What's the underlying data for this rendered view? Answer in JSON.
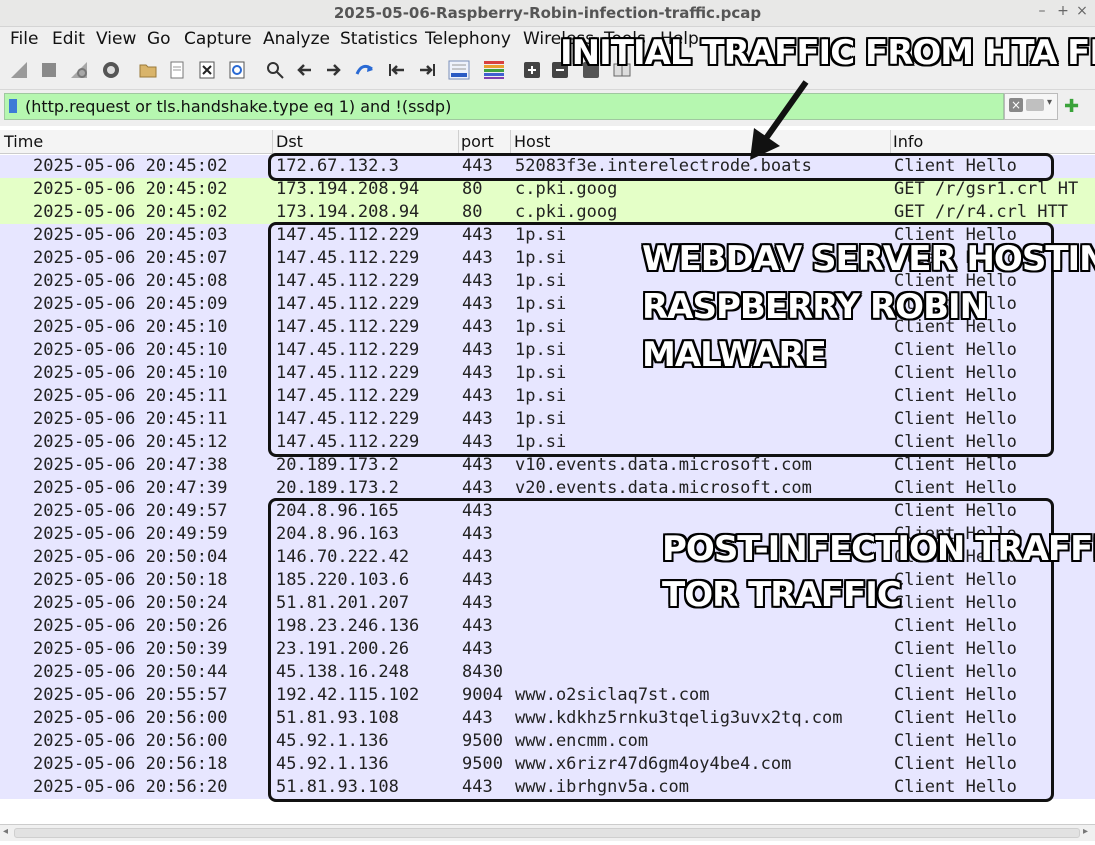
{
  "window": {
    "title": "2025-05-06-Raspberry-Robin-infection-traffic.pcap",
    "minimize": "–",
    "maximize": "+",
    "close": "×"
  },
  "menu": [
    "File",
    "Edit",
    "View",
    "Go",
    "Capture",
    "Analyze",
    "Statistics",
    "Telephony",
    "Wireless",
    "Tools",
    "Help"
  ],
  "filter": {
    "value": "(http.request or tls.handshake.type eq 1) and !(ssdp)"
  },
  "columns": {
    "time": "Time",
    "dst": "Dst",
    "port": "port",
    "host": "Host",
    "info": "Info"
  },
  "colors": {
    "row_tls": "#e7e6ff",
    "row_http": "#e4ffc7",
    "filter_bg": "#b6f7b0"
  },
  "packets": [
    {
      "time": "2025-05-06 20:45:02",
      "dst": "172.67.132.3",
      "port": "443",
      "host": "52083f3e.interelectrode.boats",
      "info": "Client Hello",
      "kind": "tls"
    },
    {
      "time": "2025-05-06 20:45:02",
      "dst": "173.194.208.94",
      "port": "80",
      "host": "c.pki.goog",
      "info": "GET /r/gsr1.crl HT",
      "kind": "http"
    },
    {
      "time": "2025-05-06 20:45:02",
      "dst": "173.194.208.94",
      "port": "80",
      "host": "c.pki.goog",
      "info": "GET /r/r4.crl HTT",
      "kind": "http"
    },
    {
      "time": "2025-05-06 20:45:03",
      "dst": "147.45.112.229",
      "port": "443",
      "host": "1p.si",
      "info": "Client Hello",
      "kind": "tls"
    },
    {
      "time": "2025-05-06 20:45:07",
      "dst": "147.45.112.229",
      "port": "443",
      "host": "1p.si",
      "info": "Client Hello",
      "kind": "tls"
    },
    {
      "time": "2025-05-06 20:45:08",
      "dst": "147.45.112.229",
      "port": "443",
      "host": "1p.si",
      "info": "Client Hello",
      "kind": "tls"
    },
    {
      "time": "2025-05-06 20:45:09",
      "dst": "147.45.112.229",
      "port": "443",
      "host": "1p.si",
      "info": "Client Hello",
      "kind": "tls"
    },
    {
      "time": "2025-05-06 20:45:10",
      "dst": "147.45.112.229",
      "port": "443",
      "host": "1p.si",
      "info": "Client Hello",
      "kind": "tls"
    },
    {
      "time": "2025-05-06 20:45:10",
      "dst": "147.45.112.229",
      "port": "443",
      "host": "1p.si",
      "info": "Client Hello",
      "kind": "tls"
    },
    {
      "time": "2025-05-06 20:45:10",
      "dst": "147.45.112.229",
      "port": "443",
      "host": "1p.si",
      "info": "Client Hello",
      "kind": "tls"
    },
    {
      "time": "2025-05-06 20:45:11",
      "dst": "147.45.112.229",
      "port": "443",
      "host": "1p.si",
      "info": "Client Hello",
      "kind": "tls"
    },
    {
      "time": "2025-05-06 20:45:11",
      "dst": "147.45.112.229",
      "port": "443",
      "host": "1p.si",
      "info": "Client Hello",
      "kind": "tls"
    },
    {
      "time": "2025-05-06 20:45:12",
      "dst": "147.45.112.229",
      "port": "443",
      "host": "1p.si",
      "info": "Client Hello",
      "kind": "tls"
    },
    {
      "time": "2025-05-06 20:47:38",
      "dst": "20.189.173.2",
      "port": "443",
      "host": "v10.events.data.microsoft.com",
      "info": "Client Hello",
      "kind": "tls"
    },
    {
      "time": "2025-05-06 20:47:39",
      "dst": "20.189.173.2",
      "port": "443",
      "host": "v20.events.data.microsoft.com",
      "info": "Client Hello",
      "kind": "tls"
    },
    {
      "time": "2025-05-06 20:49:57",
      "dst": "204.8.96.165",
      "port": "443",
      "host": "",
      "info": "Client Hello",
      "kind": "tls"
    },
    {
      "time": "2025-05-06 20:49:59",
      "dst": "204.8.96.163",
      "port": "443",
      "host": "",
      "info": "Client Hello",
      "kind": "tls"
    },
    {
      "time": "2025-05-06 20:50:04",
      "dst": "146.70.222.42",
      "port": "443",
      "host": "",
      "info": "Client Hello",
      "kind": "tls"
    },
    {
      "time": "2025-05-06 20:50:18",
      "dst": "185.220.103.6",
      "port": "443",
      "host": "",
      "info": "Client Hello",
      "kind": "tls"
    },
    {
      "time": "2025-05-06 20:50:24",
      "dst": "51.81.201.207",
      "port": "443",
      "host": "",
      "info": "Client Hello",
      "kind": "tls"
    },
    {
      "time": "2025-05-06 20:50:26",
      "dst": "198.23.246.136",
      "port": "443",
      "host": "",
      "info": "Client Hello",
      "kind": "tls"
    },
    {
      "time": "2025-05-06 20:50:39",
      "dst": "23.191.200.26",
      "port": "443",
      "host": "",
      "info": "Client Hello",
      "kind": "tls"
    },
    {
      "time": "2025-05-06 20:50:44",
      "dst": "45.138.16.248",
      "port": "8430",
      "host": "",
      "info": "Client Hello",
      "kind": "tls"
    },
    {
      "time": "2025-05-06 20:55:57",
      "dst": "192.42.115.102",
      "port": "9004",
      "host": "www.o2siclaq7st.com",
      "info": "Client Hello",
      "kind": "tls"
    },
    {
      "time": "2025-05-06 20:56:00",
      "dst": "51.81.93.108",
      "port": "443",
      "host": "www.kdkhz5rnku3tqelig3uvx2tq.com",
      "info": "Client Hello",
      "kind": "tls"
    },
    {
      "time": "2025-05-06 20:56:00",
      "dst": "45.92.1.136",
      "port": "9500",
      "host": "www.encmm.com",
      "info": "Client Hello",
      "kind": "tls"
    },
    {
      "time": "2025-05-06 20:56:18",
      "dst": "45.92.1.136",
      "port": "9500",
      "host": "www.x6rizr47d6gm4oy4be4.com",
      "info": "Client Hello",
      "kind": "tls"
    },
    {
      "time": "2025-05-06 20:56:20",
      "dst": "51.81.93.108",
      "port": "443",
      "host": "www.ibrhgnv5a.com",
      "info": "Client Hello",
      "kind": "tls"
    }
  ],
  "annotations": {
    "initial": "INITIAL TRAFFIC FROM HTA FILE",
    "webdav_1": "WEBDAV SERVER HOSTING",
    "webdav_2": "RASPBERRY ROBIN",
    "webdav_3": "MALWARE",
    "post_1": "POST-INFECTION TRAFFIC",
    "post_2": "TOR TRAFFIC"
  }
}
